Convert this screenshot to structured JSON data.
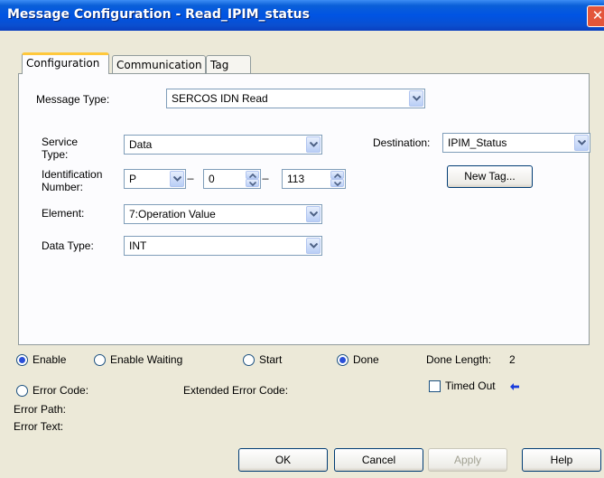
{
  "window": {
    "title": "Message Configuration - Read_IPIM_status"
  },
  "tabs": [
    {
      "label": "Configuration",
      "active": true
    },
    {
      "label": "Communication",
      "active": false
    },
    {
      "label": "Tag",
      "active": false
    }
  ],
  "config": {
    "message_type_label": "Message Type:",
    "message_type_value": "SERCOS IDN Read",
    "service_type_label_1": "Service",
    "service_type_label_2": "Type:",
    "service_type_value": "Data",
    "identification_label_1": "Identification",
    "identification_label_2": "Number:",
    "id_prefix_value": "P",
    "id_dash_1": "---",
    "id_set_value": "0",
    "id_dash_2": "---",
    "id_number_value": "113",
    "element_label": "Element:",
    "element_value": "7:Operation Value",
    "data_type_label": "Data Type:",
    "data_type_value": "INT",
    "destination_label": "Destination:",
    "destination_value": "IPIM_Status",
    "new_tag_label": "New Tag..."
  },
  "status": {
    "enable_label": "Enable",
    "enable_checked": true,
    "enable_waiting_label": "Enable Waiting",
    "enable_waiting_checked": false,
    "start_label": "Start",
    "start_checked": false,
    "done_label": "Done",
    "done_checked": true,
    "done_length_label": "Done Length:",
    "done_length_value": "2",
    "error_code_label": "Error Code:",
    "error_code_checked": false,
    "extended_error_code_label": "Extended Error Code:",
    "timed_out_label": "Timed Out",
    "timed_out_checked": false,
    "error_path_label": "Error Path:",
    "error_text_label": "Error Text:"
  },
  "buttons": {
    "ok": "OK",
    "cancel": "Cancel",
    "apply": "Apply",
    "help": "Help"
  },
  "colors": {
    "title_bar": "#0054E3",
    "close_button": "#E3553A",
    "tab_highlight": "#FFC83C",
    "radio_dot": "#2A4FD8",
    "arrow": "#1A3DDC"
  }
}
